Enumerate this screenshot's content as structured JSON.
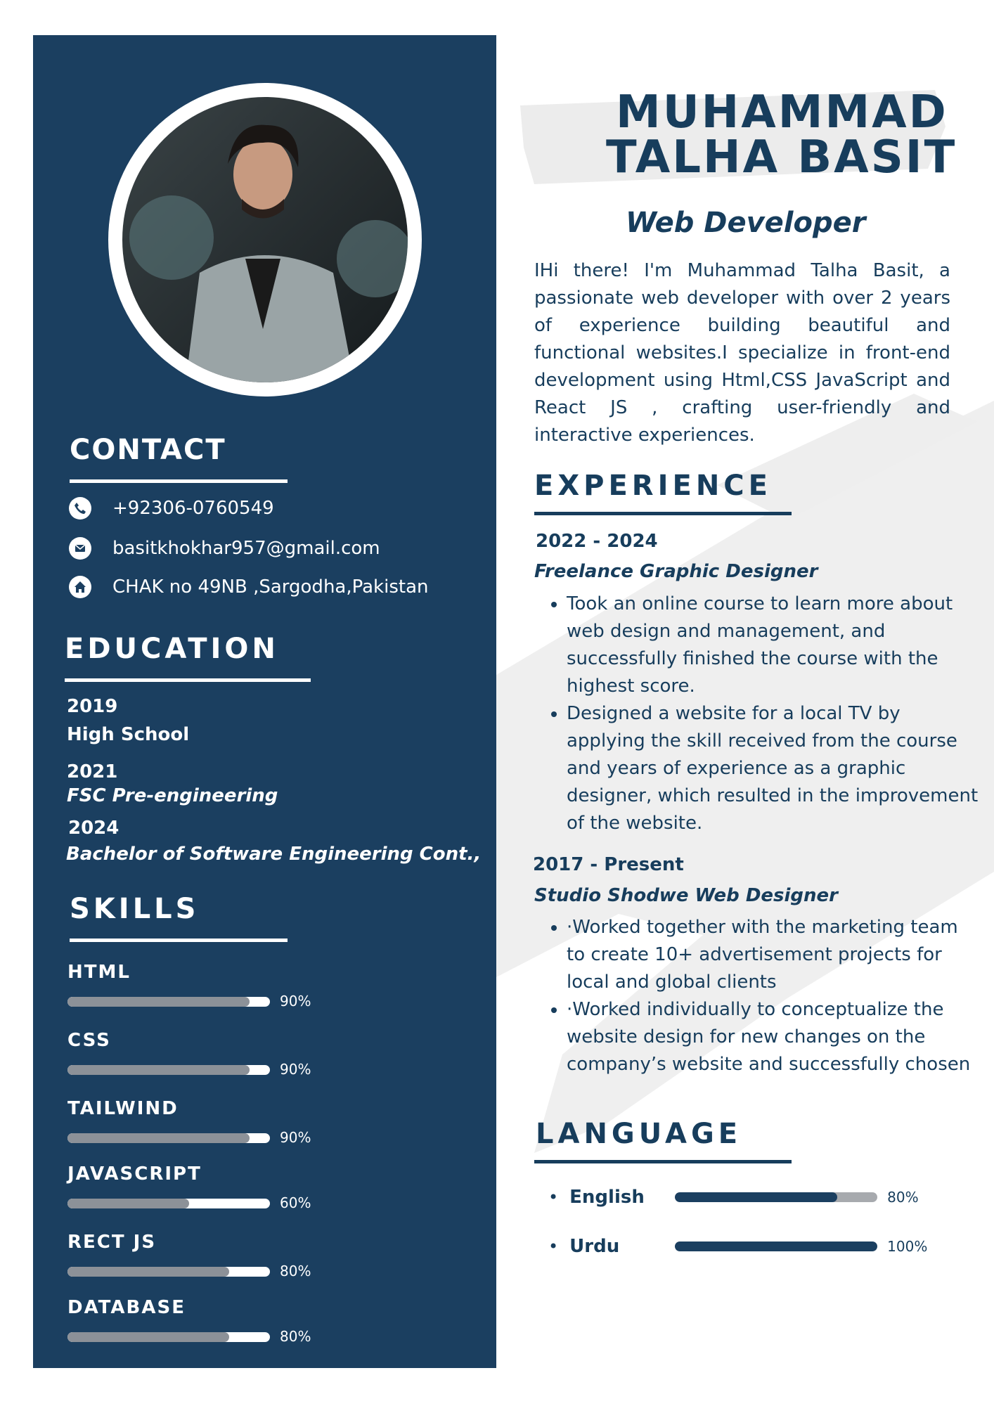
{
  "header": {
    "name_line1": "MUHAMMAD",
    "name_line2": "TALHA BASIT",
    "job_title": "Web Developer",
    "summary": "IHi there! I'm Muhammad Talha Basit, a passionate web developer with over 2 years of experience building beautiful and functional websites.I specialize in front-end development using Html,CSS JavaScript and React JS , crafting user-friendly and interactive experiences."
  },
  "contact": {
    "heading": "CONTACT",
    "items": [
      {
        "icon": "phone-icon",
        "text": "+92306-0760549"
      },
      {
        "icon": "mail-icon",
        "text": "basitkhokhar957@gmail.com"
      },
      {
        "icon": "home-icon",
        "text": "CHAK no 49NB ,Sargodha,Pakistan"
      }
    ]
  },
  "education": {
    "heading": "EDUCATION",
    "items": [
      {
        "year": "2019",
        "title": "High School"
      },
      {
        "year": "2021",
        "title": "FSC Pre-engineering"
      },
      {
        "year": "2024",
        "title": "Bachelor of Software Engineering Cont.,"
      }
    ]
  },
  "skills": {
    "heading": "SKILLS",
    "items": [
      {
        "label": "HTML",
        "level": 0.9,
        "pct": "90%"
      },
      {
        "label": "CSS",
        "level": 0.9,
        "pct": "90%"
      },
      {
        "label": "TAILWIND",
        "level": 0.9,
        "pct": "90%"
      },
      {
        "label": "JAVASCRIPT",
        "level": 0.6,
        "pct": "60%"
      },
      {
        "label": "RECT JS",
        "level": 0.8,
        "pct": "80%"
      },
      {
        "label": "DATABASE",
        "level": 0.8,
        "pct": "80%"
      }
    ]
  },
  "experience": {
    "heading": "EXPERIENCE",
    "jobs": [
      {
        "period": "2022 - 2024",
        "role": "Freelance Graphic Designer",
        "bullets": [
          "Took an online course to learn more about web design and management, and successfully finished the course with the highest score.",
          "Designed a website for a local TV by applying the skill received from the course and years of experience as a graphic designer, which resulted in the improvement of the website."
        ]
      },
      {
        "period": "2017 - Present",
        "role": "Studio Shodwe Web Designer",
        "bullets": [
          "·Worked together with the marketing team to create 10+ advertisement projects for local and global clients",
          "·Worked individually to conceptualize the website design for new changes on the company’s website and successfully chosen"
        ]
      }
    ]
  },
  "language": {
    "heading": "LANGUAGE",
    "items": [
      {
        "label": "English",
        "level": 0.8,
        "pct": "80%"
      },
      {
        "label": "Urdu",
        "level": 1.0,
        "pct": "100%"
      }
    ]
  },
  "colors": {
    "sidebar": "#1b3f60",
    "text": "#173d5c",
    "brush": "#ececec",
    "bar_fill_grey": "#8c9198"
  }
}
